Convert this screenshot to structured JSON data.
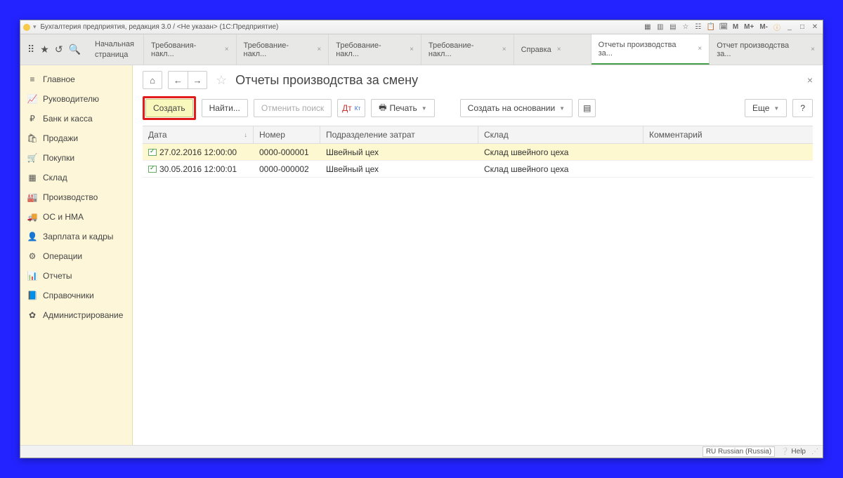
{
  "titlebar": {
    "text": "Бухгалтерия предприятия, редакция 3.0 / <Не указан> (1С:Предприятие)"
  },
  "tabs": {
    "start": "Начальная\nстраница",
    "items": [
      "Требования-накл...",
      "Требование-накл...",
      "Требование-накл...",
      "Требование-накл...",
      "Справка",
      "Отчеты производства за...",
      "Отчет производства за..."
    ]
  },
  "sidebar": [
    {
      "icon": "≡",
      "label": "Главное"
    },
    {
      "icon": "📈",
      "label": "Руководителю"
    },
    {
      "icon": "₽",
      "label": "Банк и касса"
    },
    {
      "icon": "🛍",
      "label": "Продажи"
    },
    {
      "icon": "🛒",
      "label": "Покупки"
    },
    {
      "icon": "▦",
      "label": "Склад"
    },
    {
      "icon": "🏭",
      "label": "Производство"
    },
    {
      "icon": "🚚",
      "label": "ОС и НМА"
    },
    {
      "icon": "👤",
      "label": "Зарплата и кадры"
    },
    {
      "icon": "⚙",
      "label": "Операции"
    },
    {
      "icon": "📊",
      "label": "Отчеты"
    },
    {
      "icon": "📘",
      "label": "Справочники"
    },
    {
      "icon": "✿",
      "label": "Администрирование"
    }
  ],
  "page": {
    "title": "Отчеты производства за смену"
  },
  "toolbar": {
    "create": "Создать",
    "find": "Найти...",
    "cancel_find": "Отменить поиск",
    "print": "Печать",
    "create_based": "Создать на основании",
    "more": "Еще",
    "help": "?"
  },
  "columns": {
    "date": "Дата",
    "num": "Номер",
    "dep": "Подразделение затрат",
    "wh": "Склад",
    "comm": "Комментарий"
  },
  "rows": [
    {
      "date": "27.02.2016 12:00:00",
      "num": "0000-000001",
      "dep": "Швейный цех",
      "wh": "Склад швейного цеха",
      "sel": true
    },
    {
      "date": "30.05.2016 12:00:01",
      "num": "0000-000002",
      "dep": "Швейный цех",
      "wh": "Склад швейного цеха",
      "sel": false
    }
  ],
  "status": {
    "lang": "RU Russian (Russia)",
    "help": "Help"
  },
  "sysicons": [
    "M",
    "M+",
    "M-"
  ]
}
